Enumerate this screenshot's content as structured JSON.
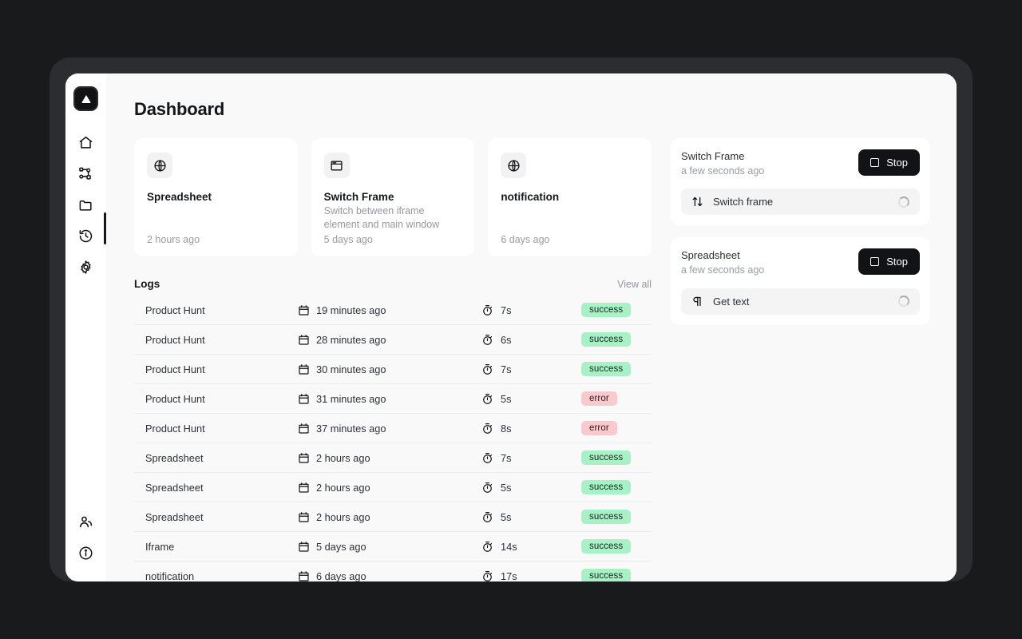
{
  "app": {
    "logo_icon": "triangle-logo-icon",
    "page_title": "Dashboard"
  },
  "sidebar": {
    "items": [
      {
        "name": "home",
        "icon": "home-icon",
        "active": true
      },
      {
        "name": "workflows",
        "icon": "workflow-icon",
        "active": false
      },
      {
        "name": "files",
        "icon": "folder-icon",
        "active": false
      },
      {
        "name": "history",
        "icon": "history-icon",
        "active": false
      },
      {
        "name": "settings",
        "icon": "gear-icon",
        "active": false
      }
    ],
    "bottom_items": [
      {
        "name": "team",
        "icon": "users-icon"
      },
      {
        "name": "info",
        "icon": "info-icon"
      }
    ]
  },
  "flow_cards": [
    {
      "icon": "globe-icon",
      "title": "Spreadsheet",
      "description": "",
      "time": "2 hours ago"
    },
    {
      "icon": "app-window-icon",
      "title": "Switch Frame",
      "description": "Switch between iframe element and main window",
      "time": "5 days ago"
    },
    {
      "icon": "globe-icon",
      "title": "notification",
      "description": "",
      "time": "6 days ago"
    }
  ],
  "logs": {
    "title": "Logs",
    "view_all_label": "View all",
    "calendar_icon": "calendar-icon",
    "timer_icon": "stopwatch-icon",
    "rows": [
      {
        "name": "Product Hunt",
        "when": "19 minutes ago",
        "duration": "7s",
        "status": "success"
      },
      {
        "name": "Product Hunt",
        "when": "28 minutes ago",
        "duration": "6s",
        "status": "success"
      },
      {
        "name": "Product Hunt",
        "when": "30 minutes ago",
        "duration": "7s",
        "status": "success"
      },
      {
        "name": "Product Hunt",
        "when": "31 minutes ago",
        "duration": "5s",
        "status": "error"
      },
      {
        "name": "Product Hunt",
        "when": "37 minutes ago",
        "duration": "8s",
        "status": "error"
      },
      {
        "name": "Spreadsheet",
        "when": "2 hours ago",
        "duration": "7s",
        "status": "success"
      },
      {
        "name": "Spreadsheet",
        "when": "2 hours ago",
        "duration": "5s",
        "status": "success"
      },
      {
        "name": "Spreadsheet",
        "when": "2 hours ago",
        "duration": "5s",
        "status": "success"
      },
      {
        "name": "Iframe",
        "when": "5 days ago",
        "duration": "14s",
        "status": "success"
      },
      {
        "name": "notification",
        "when": "6 days ago",
        "duration": "17s",
        "status": "success"
      }
    ]
  },
  "running_panels": [
    {
      "title": "Switch Frame",
      "subtitle": "a few seconds ago",
      "stop_label": "Stop",
      "task_icon": "arrows-up-down-icon",
      "task_label": "Switch frame"
    },
    {
      "title": "Spreadsheet",
      "subtitle": "a few seconds ago",
      "stop_label": "Stop",
      "task_icon": "pilcrow-icon",
      "task_label": "Get text"
    }
  ],
  "colors": {
    "accent_dark": "#121316",
    "success_bg": "#a8f0c6",
    "error_bg": "#fac9ce",
    "page_bg": "#f9f9fa",
    "card_bg": "#ffffff"
  }
}
